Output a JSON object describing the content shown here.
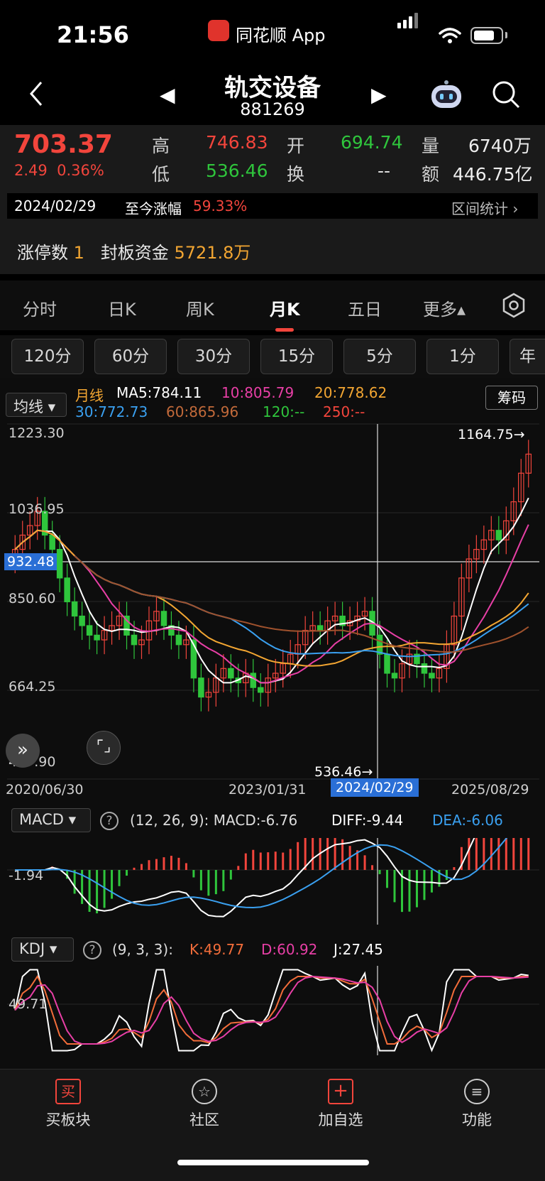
{
  "status_bar": {
    "time": "21:56",
    "app_name": "同花顺 App"
  },
  "header": {
    "name": "轨交设备",
    "code": "881269"
  },
  "quote": {
    "price": "703.37",
    "change": "2.49",
    "change_pct": "0.36%",
    "high_label": "高",
    "high": "746.83",
    "low_label": "低",
    "low": "536.46",
    "open_label": "开",
    "open": "694.74",
    "turnover_label": "换",
    "turnover": "--",
    "volume_label": "量",
    "volume": "6740万",
    "amount_label": "额",
    "amount": "446.75亿",
    "date": "2024/02/29",
    "since_label": "至今涨幅",
    "since_value": "59.33%",
    "range_stat": "区间统计",
    "limit_label": "涨停数",
    "limit_count": "1",
    "seal_label": "封板资金",
    "seal_value": "5721.8万"
  },
  "tabs": [
    "分时",
    "日K",
    "周K",
    "月K",
    "五日",
    "更多"
  ],
  "periods": [
    "120分",
    "60分",
    "30分",
    "15分",
    "5分",
    "1分",
    "年"
  ],
  "ma": {
    "selector": "均线",
    "chip": "筹码",
    "line_label": "月线",
    "ma5": "MA5:784.11",
    "ma10": "10:805.79",
    "ma20": "20:778.62",
    "ma30": "30:772.73",
    "ma60": "60:865.96",
    "ma120": "120:--",
    "ma250": "250:--"
  },
  "main_chart": {
    "y_ticks": [
      "1223.30",
      "1036.95",
      "850.60",
      "664.25",
      "477.90"
    ],
    "crosshair_value": "932.48",
    "max_label": "1164.75→",
    "min_label": "536.46→",
    "x_labels": [
      "2020/06/30",
      "2023/01/31",
      "2024/02/29",
      "2025/08/29"
    ],
    "marks": [
      "3",
      "4",
      "5",
      "6",
      "7",
      "8",
      "9",
      "2"
    ]
  },
  "macd": {
    "selector": "MACD",
    "params": "(12, 26, 9):",
    "macd": "MACD:-6.76",
    "diff": "DIFF:-9.44",
    "dea": "DEA:-6.06",
    "tick": "-1.94"
  },
  "kdj": {
    "selector": "KDJ",
    "params": "(9, 3, 3):",
    "k": "K:49.77",
    "d": "D:60.92",
    "j": "J:27.45",
    "tick": "49.71"
  },
  "bottom_nav": [
    "买板块",
    "社区",
    "加自选",
    "功能"
  ],
  "colors": {
    "up": "#f2453c",
    "down": "#2fc53c",
    "ma5": "#ffffff",
    "ma10": "#e83fa6",
    "ma20": "#f3a632",
    "ma30": "#3aa0f0",
    "ma60": "#a0522d"
  }
}
